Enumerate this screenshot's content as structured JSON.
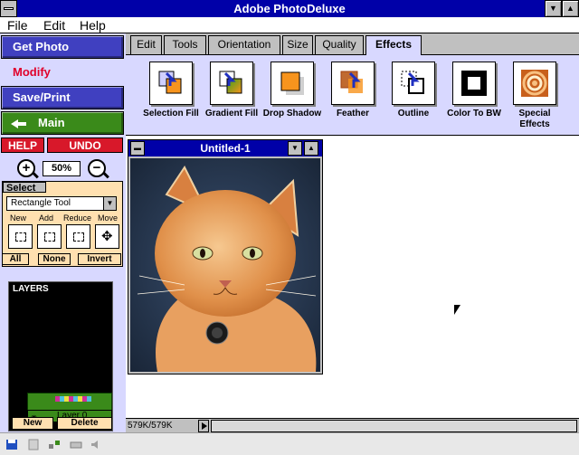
{
  "app": {
    "title": "Adobe PhotoDeluxe"
  },
  "menu": [
    {
      "label": "File",
      "accel": "F"
    },
    {
      "label": "Edit",
      "accel": "E"
    },
    {
      "label": "Help",
      "accel": "H"
    }
  ],
  "nav": {
    "get_photo": "Get Photo",
    "modify": "Modify",
    "save_print": "Save/Print",
    "main": "Main",
    "help": "HELP",
    "undo": "UNDO"
  },
  "zoom": {
    "value": "50%"
  },
  "select": {
    "title": "Select",
    "tool": "Rectangle Tool",
    "modes": [
      "New",
      "Add",
      "Reduce",
      "Move"
    ],
    "all": "All",
    "none": "None",
    "invert": "Invert"
  },
  "layers": {
    "title": "LAYERS",
    "layer_name": "Layer 0",
    "new": "New",
    "delete": "Delete"
  },
  "tabs": [
    {
      "label": "Edit",
      "active": false
    },
    {
      "label": "Tools",
      "active": false
    },
    {
      "label": "Orientation",
      "active": false
    },
    {
      "label": "Size",
      "active": false
    },
    {
      "label": "Quality",
      "active": false
    },
    {
      "label": "Effects",
      "active": true
    }
  ],
  "effects": [
    {
      "label": "Selection Fill",
      "icon": "selection-fill-icon"
    },
    {
      "label": "Gradient Fill",
      "icon": "gradient-fill-icon"
    },
    {
      "label": "Drop Shadow",
      "icon": "drop-shadow-icon"
    },
    {
      "label": "Feather",
      "icon": "feather-icon"
    },
    {
      "label": "Outline",
      "icon": "outline-icon"
    },
    {
      "label": "Color To BW",
      "icon": "color-to-bw-icon"
    },
    {
      "label": "Special Effects",
      "icon": "special-effects-icon"
    }
  ],
  "document": {
    "title": "Untitled-1",
    "image": "orange-cat-photo"
  },
  "status": {
    "memory": "579K/579K"
  },
  "colors": {
    "titlebar": "#0000a8",
    "panel": "#d8d8ff",
    "nav_blue": "#4040c0",
    "nav_green": "#3a8a1a",
    "red": "#d8182a",
    "orange": "#f7941d",
    "select_bg": "#ffe0b0"
  }
}
